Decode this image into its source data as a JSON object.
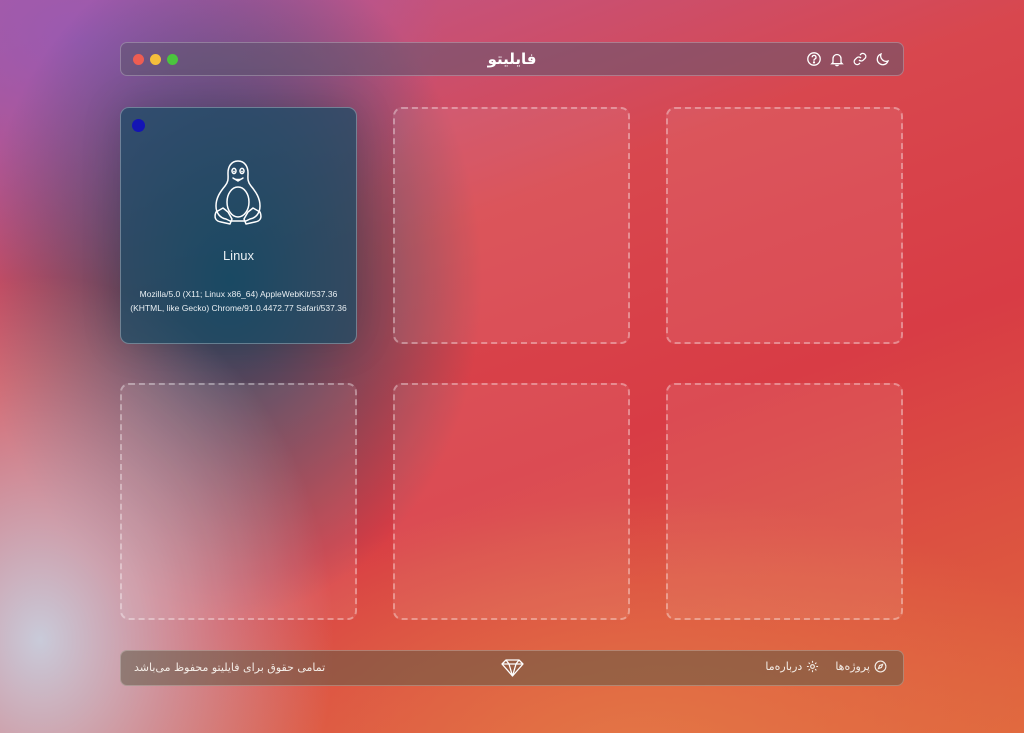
{
  "window": {
    "title": "فایلیتو",
    "toolbar_icons": [
      "help-icon",
      "bell-icon",
      "link-icon",
      "moon-icon"
    ]
  },
  "devices": [
    {
      "status_color": "#1414b4",
      "os_icon": "linux-tux-icon",
      "os_name": "Linux",
      "user_agent": "Mozilla/5.0 (X11; Linux x86_64) AppleWebKit/537.36 (KHTML, like Gecko) Chrome/91.0.4472.77 Safari/537.36"
    }
  ],
  "footer": {
    "copyright": "تمامی حقوق برای فایلیتو محفوظ می‌باشد",
    "logo_icon": "diamond-logo-icon",
    "nav": [
      {
        "label": "پروژه‌ها",
        "icon": "compass-icon"
      },
      {
        "label": "درباره‌ما",
        "icon": "gear-icon"
      }
    ]
  }
}
